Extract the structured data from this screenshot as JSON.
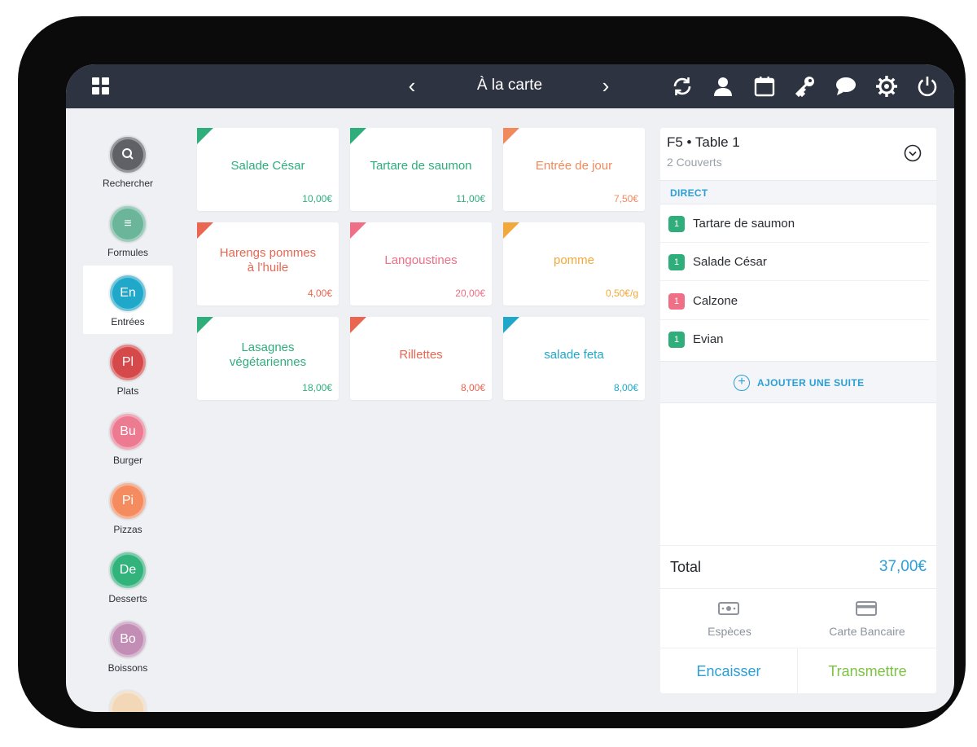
{
  "topbar": {
    "title": "À la carte",
    "prev_icon": "chevron-left-icon",
    "next_icon": "chevron-right-icon",
    "prev_glyph": "‹",
    "next_glyph": "›",
    "tools": [
      "sync-icon",
      "user-icon",
      "calendar-icon",
      "key-icon",
      "chat-icon",
      "gear-icon",
      "power-icon"
    ]
  },
  "sidebar": {
    "items": [
      {
        "abbr": "",
        "label": "Rechercher",
        "color": "#5f6166",
        "icon": "search-icon"
      },
      {
        "abbr": "≡",
        "label": "Formules",
        "color": "#6bb59a",
        "icon": "menu-icon"
      },
      {
        "abbr": "En",
        "label": "Entrées",
        "color": "#1fa8c9",
        "active": true
      },
      {
        "abbr": "Pl",
        "label": "Plats",
        "color": "#d6494a"
      },
      {
        "abbr": "Bu",
        "label": "Burger",
        "color": "#ec7b92"
      },
      {
        "abbr": "Pi",
        "label": "Pizzas",
        "color": "#f48c5f"
      },
      {
        "abbr": "De",
        "label": "Desserts",
        "color": "#33b37c"
      },
      {
        "abbr": "Bo",
        "label": "Boissons",
        "color": "#c38eb6"
      }
    ]
  },
  "products": [
    {
      "name": "Salade César",
      "price": "10,00€",
      "color": "#2fae7c"
    },
    {
      "name": "Tartare de saumon",
      "price": "11,00€",
      "color": "#2fae7c"
    },
    {
      "name": "Entrée de jour",
      "price": "7,50€",
      "color": "#f08a5d"
    },
    {
      "name": "Harengs pommes\nà l'huile",
      "price": "4,00€",
      "color": "#ea6651"
    },
    {
      "name": "Langoustines",
      "price": "20,00€",
      "color": "#ee6f86"
    },
    {
      "name": "pomme",
      "price": "0,50€/g",
      "color": "#f2a93b"
    },
    {
      "name": "Lasagnes\nvégétariennes",
      "price": "18,00€",
      "color": "#2fae7c"
    },
    {
      "name": "Rillettes",
      "price": "8,00€",
      "color": "#ea6651"
    },
    {
      "name": "salade feta",
      "price": "8,00€",
      "color": "#1fa8c9"
    }
  ],
  "order": {
    "table": "F5 • Table 1",
    "covers": "2 Couverts",
    "section": "DIRECT",
    "lines": [
      {
        "qty": "1",
        "name": "Tartare de saumon",
        "color": "#2fae7c"
      },
      {
        "qty": "1",
        "name": "Salade César",
        "color": "#2fae7c"
      },
      {
        "qty": "1",
        "name": "Calzone",
        "color": "#ee6f86"
      },
      {
        "qty": "1",
        "name": "Evian",
        "color": "#2fae7c"
      }
    ],
    "add_suite": "AJOUTER UNE SUITE",
    "total_label": "Total",
    "total_value": "37,00€",
    "payments": [
      {
        "label": "Espèces",
        "icon": "cash-icon"
      },
      {
        "label": "Carte Bancaire",
        "icon": "credit-card-icon"
      }
    ],
    "encaisser": "Encaisser",
    "transmettre": "Transmettre"
  },
  "colors": {
    "accent": "#2b9fd6",
    "green_action": "#7cc243",
    "topbar": "#2d3340"
  }
}
